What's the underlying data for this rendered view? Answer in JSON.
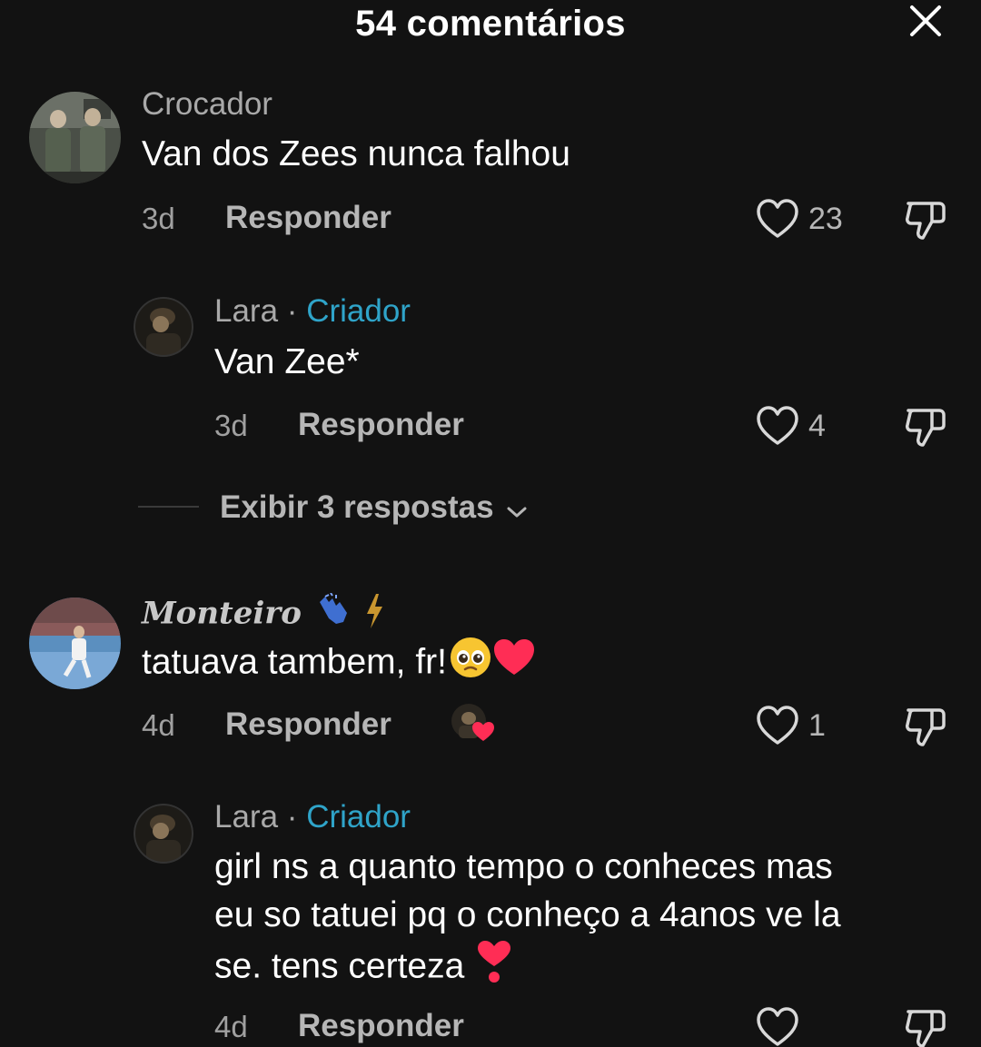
{
  "header": {
    "title": "54 comentários",
    "close_icon": "close-icon"
  },
  "comments": [
    {
      "username": "Crocador",
      "text": "Van dos Zees nunca falhou",
      "time": "3d",
      "reply_label": "Responder",
      "likes": "23"
    },
    {
      "username": "Lara",
      "separator": "·",
      "creator_badge": "Criador",
      "text": "Van Zee*",
      "time": "3d",
      "reply_label": "Responder",
      "likes": "4"
    },
    {
      "username": "Monteiro",
      "text": "tatuava tambem, fr!",
      "time": "4d",
      "reply_label": "Responder",
      "likes": "1"
    },
    {
      "username": "Lara",
      "separator": "·",
      "creator_badge": "Criador",
      "text_lines": [
        "girl ns a quanto tempo o conheces mas",
        "eu so tatuei pq o conheço a 4anos ve la",
        "se. tens certeza"
      ],
      "time": "4d",
      "reply_label": "Responder"
    }
  ],
  "view_replies": {
    "label": "Exibir 3 respostas"
  },
  "colors": {
    "background": "#121212",
    "creator": "#2fa4c9",
    "heart": "#ff2d55"
  }
}
